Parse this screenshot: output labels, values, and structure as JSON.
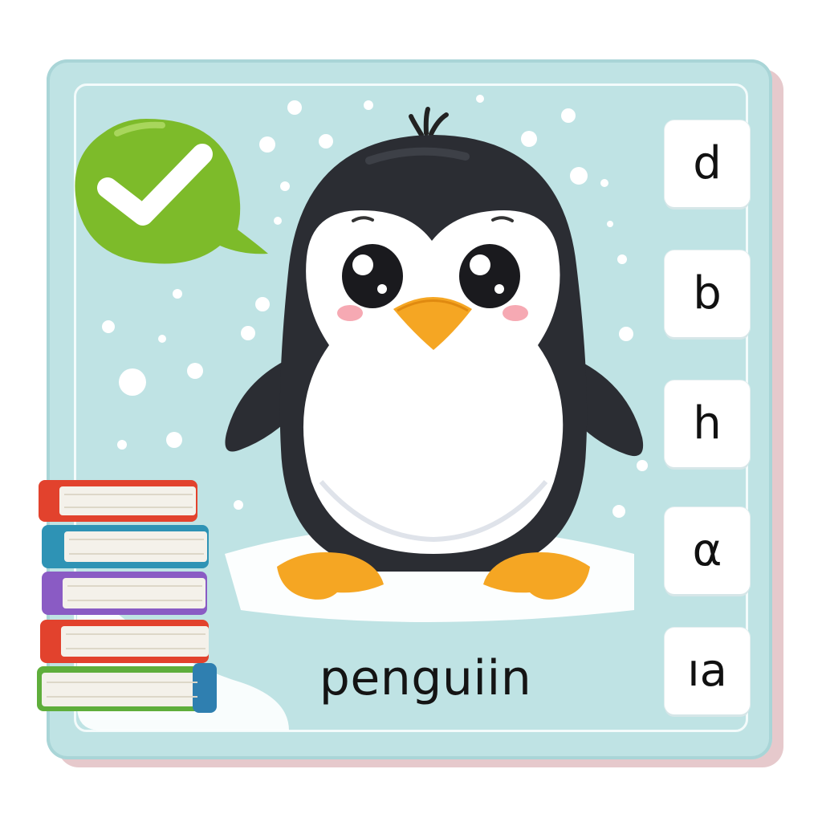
{
  "card": {
    "background": "#bfe3e4",
    "frame_color": "#f3fbfb"
  },
  "feedback": {
    "icon": "check-icon",
    "status": "correct",
    "color": "#7dbb2a"
  },
  "illustration": {
    "subject": "penguin-icon",
    "decor": [
      "snowflakes",
      "books-stack-icon"
    ]
  },
  "word": {
    "text": "penguiin"
  },
  "options": [
    {
      "label": "d"
    },
    {
      "label": "b"
    },
    {
      "label": "h"
    },
    {
      "label": "α"
    },
    {
      "label": "ıa"
    }
  ]
}
